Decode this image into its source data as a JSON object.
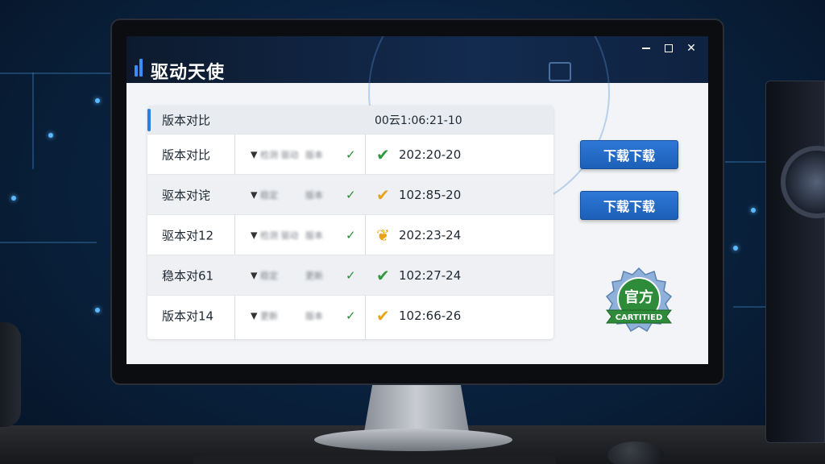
{
  "app": {
    "title": "驱动天使"
  },
  "window_controls": {
    "close_symbol": "✕"
  },
  "table": {
    "header": {
      "name": "版本对比",
      "value": "00云1:06:21-10"
    },
    "rows": [
      {
        "name": "版本对比",
        "blur_a": "检测 驱动",
        "blur_b": "版本",
        "status_icon": "check-icon",
        "status_color": "#2e9a3c",
        "value": "202:20-20"
      },
      {
        "name": "驱本对诧",
        "blur_a": "稳定",
        "blur_b": "版本",
        "status_icon": "check-icon",
        "status_color": "#e8a317",
        "value": "102:85-20"
      },
      {
        "name": "驱本对12",
        "blur_a": "检测 驱动",
        "blur_b": "版本",
        "status_icon": "heart-check-icon",
        "status_color": "#e8a317",
        "value": "202:23-24"
      },
      {
        "name": "稳本对61",
        "blur_a": "稳定",
        "blur_b": "更新",
        "status_icon": "check-icon",
        "status_color": "#2e9a3c",
        "value": "102:27-24"
      },
      {
        "name": "版本对14",
        "blur_a": "更新",
        "blur_b": "版本",
        "status_icon": "check-icon",
        "status_color": "#e8a317",
        "value": "102:66-26"
      }
    ]
  },
  "buttons": {
    "download_1": "下载下载",
    "download_2": "下载下载"
  },
  "badge": {
    "title": "官方",
    "ribbon": "CARTITIED"
  },
  "colors": {
    "accent": "#2f7de1",
    "button": "#1f66c2",
    "titlebar": "#0f2240",
    "badge_green": "#2e8b3a"
  }
}
